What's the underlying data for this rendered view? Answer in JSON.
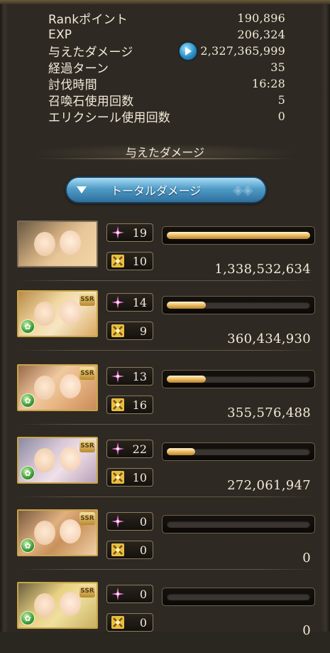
{
  "stats": [
    {
      "label": "Rankポイント",
      "value": "190,896"
    },
    {
      "label": "EXP",
      "value": "206,324"
    },
    {
      "label": "与えたダメージ",
      "value": "2,327,365,999",
      "has_play_icon": true
    },
    {
      "label": "経過ターン",
      "value": "35"
    },
    {
      "label": "討伐時間",
      "value": "16:28"
    },
    {
      "label": "召喚石使用回数",
      "value": "5"
    },
    {
      "label": "エリクシール使用回数",
      "value": "0"
    }
  ],
  "section_title": "与えたダメージ",
  "dropdown": {
    "label": "トータルダメージ",
    "arrow_icon": "triangle-down-icon"
  },
  "colors": {
    "bar_fill": "#e9b65a",
    "accent_blue": "#4f9cc7",
    "text": "#f2ead8"
  },
  "entries": [
    {
      "ssr": false,
      "skills": "19",
      "ougi": "10",
      "bar_percent": 100,
      "damage": "1,338,532,634"
    },
    {
      "ssr": true,
      "ssr_label": "SSR",
      "skills": "14",
      "ougi": "9",
      "bar_percent": 27,
      "damage": "360,434,930"
    },
    {
      "ssr": true,
      "ssr_label": "SSR",
      "skills": "13",
      "ougi": "16",
      "bar_percent": 27,
      "damage": "355,576,488"
    },
    {
      "ssr": true,
      "ssr_label": "SSR",
      "skills": "22",
      "ougi": "10",
      "bar_percent": 20,
      "damage": "272,061,947"
    },
    {
      "ssr": true,
      "ssr_label": "SSR",
      "skills": "0",
      "ougi": "0",
      "bar_percent": 0,
      "damage": "0"
    },
    {
      "ssr": true,
      "ssr_label": "SSR",
      "skills": "0",
      "ougi": "0",
      "bar_percent": 0,
      "damage": "0"
    }
  ]
}
